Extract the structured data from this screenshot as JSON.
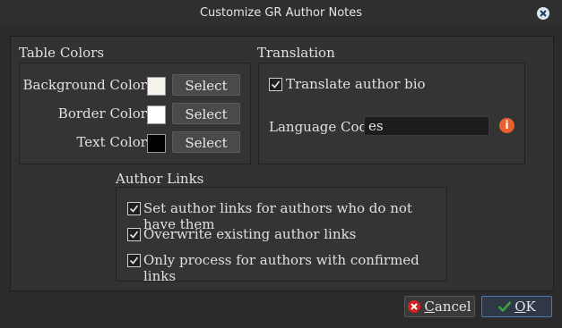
{
  "window": {
    "title": "Customize GR Author Notes"
  },
  "table_colors": {
    "title": "Table Colors",
    "rows": [
      {
        "label": "Background Color:",
        "swatch_color": "#f4f2ea",
        "button": "Select"
      },
      {
        "label": "Border Color:",
        "swatch_color": "#ffffff",
        "button": "Select"
      },
      {
        "label": "Text Color:",
        "swatch_color": "#000000",
        "button": "Select"
      }
    ]
  },
  "translation": {
    "title": "Translation",
    "translate_label": "Translate author bio",
    "translate_checked": true,
    "language_label": "Language Code",
    "language_value": "es",
    "info_glyph": "i"
  },
  "author_links": {
    "title": "Author Links",
    "options": [
      {
        "label": "Set author links for authors who do not have them",
        "checked": true
      },
      {
        "label": "Overwrite existing author links",
        "checked": true
      },
      {
        "label": "Only process for authors with confirmed links",
        "checked": true
      }
    ]
  },
  "footer": {
    "cancel_rest": "ancel",
    "cancel_mnemonic": "C",
    "ok_rest": "K",
    "ok_mnemonic": "O"
  },
  "colors": {
    "accent": "#4a78b8",
    "info": "#e8612c",
    "cancel_icon": "#d02020",
    "ok_icon": "#3aa33a"
  }
}
